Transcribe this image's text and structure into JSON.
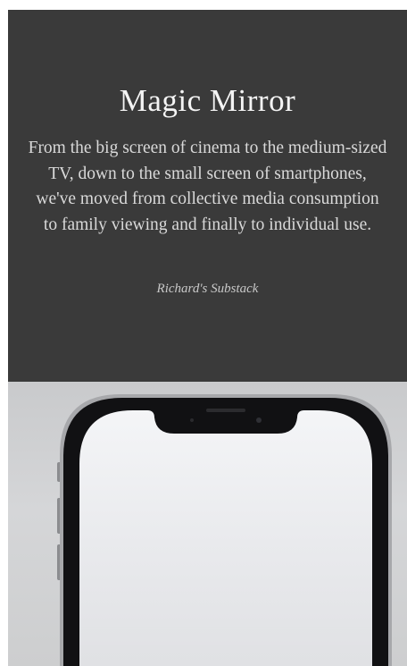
{
  "article": {
    "title": "Magic Mirror",
    "body": "From the big screen of cinema to the medium-sized TV, down to the small screen of smartphones, we've moved from collective media consumption to family viewing and finally to individual use.",
    "source": "Richard's Substack"
  },
  "image": {
    "subject": "smartphone-icon"
  }
}
